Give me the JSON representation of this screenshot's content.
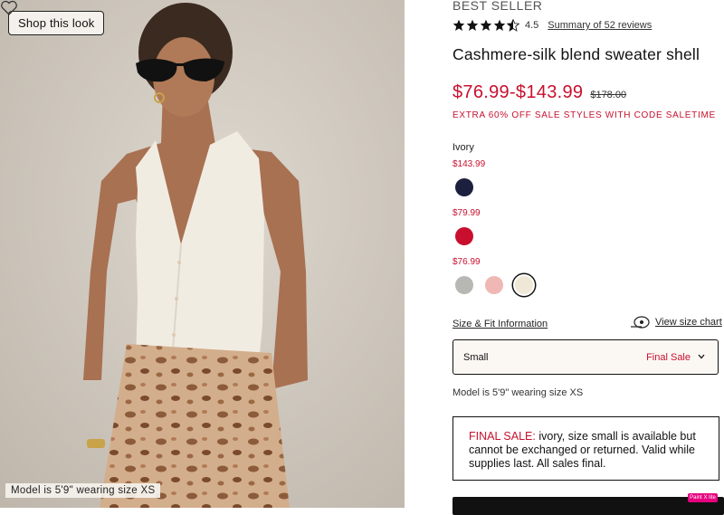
{
  "image": {
    "shop_label": "Shop this look",
    "caption": "Model is 5'9\" wearing size XS",
    "wishlist_icon": "heart-icon"
  },
  "product": {
    "badge": "BEST SELLER",
    "rating": 4.5,
    "rating_text": "4.5",
    "reviews_link": "Summary of 52 reviews",
    "title": "Cashmere-silk blend sweater shell",
    "price_range": "$76.99-$143.99",
    "original_price": "$178.00",
    "promo": "EXTRA 60% OFF SALE STYLES WITH CODE SALETIME",
    "selected_color": "Ivory",
    "color_groups": [
      {
        "price": "$143.99",
        "swatches": [
          {
            "name": "navy",
            "color": "#1c1f3d"
          }
        ]
      },
      {
        "price": "$79.99",
        "swatches": [
          {
            "name": "red",
            "color": "#c8102e"
          }
        ]
      },
      {
        "price": "$76.99",
        "swatches": [
          {
            "name": "heather-grey",
            "color": "#b7b8b4"
          },
          {
            "name": "pink",
            "color": "#efb8b4"
          },
          {
            "name": "ivory",
            "color": "#efe8d6",
            "selected": true
          }
        ]
      }
    ],
    "size_fit_link": "Size & Fit Information",
    "size_chart_link": "View size chart",
    "size_chart_icon": "tape-measure-icon",
    "size_select": {
      "value": "Small",
      "note": "Final Sale"
    },
    "model_note": "Model is 5'9\" wearing size XS",
    "final_sale": {
      "label": "FINAL SALE:",
      "text": " ivory, size small is available but cannot be exchanged or returned. Valid while supplies last. All sales final."
    }
  },
  "colors": {
    "accent_red": "#c8102e",
    "text": "#111111"
  },
  "overlay_badge": "Paint X lite"
}
